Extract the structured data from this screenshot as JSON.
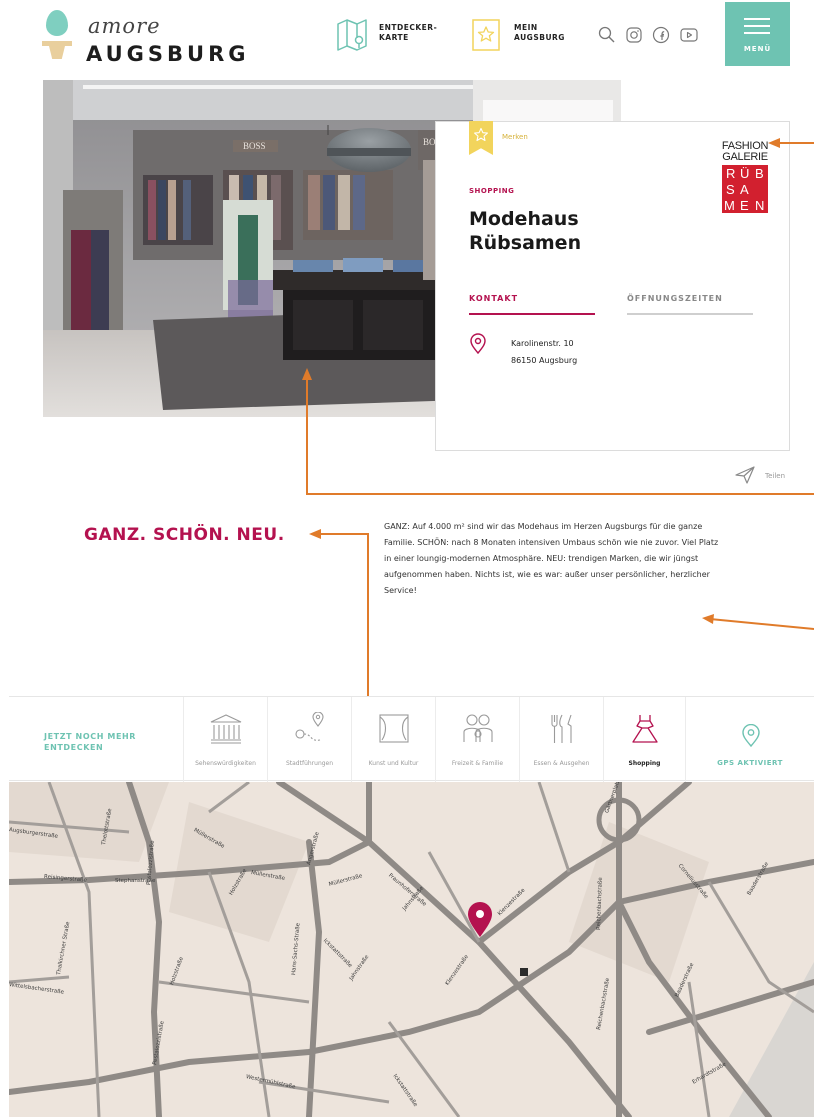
{
  "header": {
    "logo_script": "amore",
    "logo_word": "AUGSBURG",
    "nav": [
      {
        "label_l1": "ENTDECKER-",
        "label_l2": "KARTE"
      },
      {
        "label_l1": "MEIN",
        "label_l2": "AUGSBURG"
      }
    ],
    "menu_label": "MENÜ"
  },
  "card": {
    "bookmark_label": "Merken",
    "category": "SHOPPING",
    "title_l1": "Modehaus",
    "title_l2": "Rübsamen",
    "brand_logo": {
      "l1": "FASHION",
      "l2": "GALERIE",
      "cells": [
        "R",
        "Ü",
        "B",
        "S",
        "A",
        "M",
        "E",
        "N"
      ]
    },
    "tabs": [
      "KONTAKT",
      "ÖFFNUNGSZEITEN"
    ],
    "address_l1": "Karolinenstr. 10",
    "address_l2": "86150 Augsburg"
  },
  "share_label": "Teilen",
  "slogan": "GANZ. SCHÖN. NEU.",
  "description": "GANZ: Auf 4.000 m² sind wir das Modehaus im Herzen Augsburgs für die ganze Familie. SCHÖN: nach 8 Monaten intensiven Umbaus schön wie nie zuvor. Viel Platz in einer loungig-modernen Atmosphäre. NEU: trendigen Marken, die wir jüngst aufgenommen haben. Nichts ist, wie es war: außer unser persönlicher, herzlicher Service!",
  "category_bar": {
    "more_l1": "JETZT NOCH MEHR",
    "more_l2": "ENTDECKEN",
    "items": [
      {
        "label": "Sehenswürdigkeiten",
        "icon": "landmark-icon"
      },
      {
        "label": "Stadtführungen",
        "icon": "route-icon"
      },
      {
        "label": "Kunst und Kultur",
        "icon": "theater-icon"
      },
      {
        "label": "Freizeit & Familie",
        "icon": "family-icon"
      },
      {
        "label": "Essen & Ausgehen",
        "icon": "cutlery-icon"
      },
      {
        "label": "Shopping",
        "icon": "dress-icon",
        "active": true
      }
    ],
    "gps_label": "GPS AKTIVIERT"
  },
  "map": {
    "streets": [
      "Augsburgerstraße",
      "Thelottstraße",
      "Reisingerstraße",
      "Stephanstraße",
      "Pestalozzistraße",
      "Müllerstraße",
      "Müllerstraße",
      "Müllerstraße",
      "Angerstraße",
      "Fraunhoferstraße",
      "Holzstraße",
      "Hans-Sachs-Straße",
      "Jahnstraße",
      "Ickstattstraße",
      "Jahnstraße",
      "Klenzestraße",
      "Klenzestraße",
      "Reichenbachstraße",
      "Gärtnerplatz",
      "Corneliusstraße",
      "Baaderstraße",
      "Baaderstraße",
      "Erhardtstraße",
      "Westermühlstraße",
      "Wittelsbacherstraße",
      "Thalkirchner Straße",
      "Holzstraße",
      "Pestalozzistraße",
      "Ickstattstraße",
      "Reichenbachstraße"
    ],
    "colors": {
      "background": "#ede4dc",
      "road": "#8f8a86",
      "road_major": "#7a7572",
      "pin": "#b4124f"
    }
  },
  "colors": {
    "accent_teal": "#6ec3b2",
    "accent_crimson": "#b4124f",
    "bookmark_yellow": "#f2d45c",
    "annotation_orange": "#e07b2a"
  }
}
